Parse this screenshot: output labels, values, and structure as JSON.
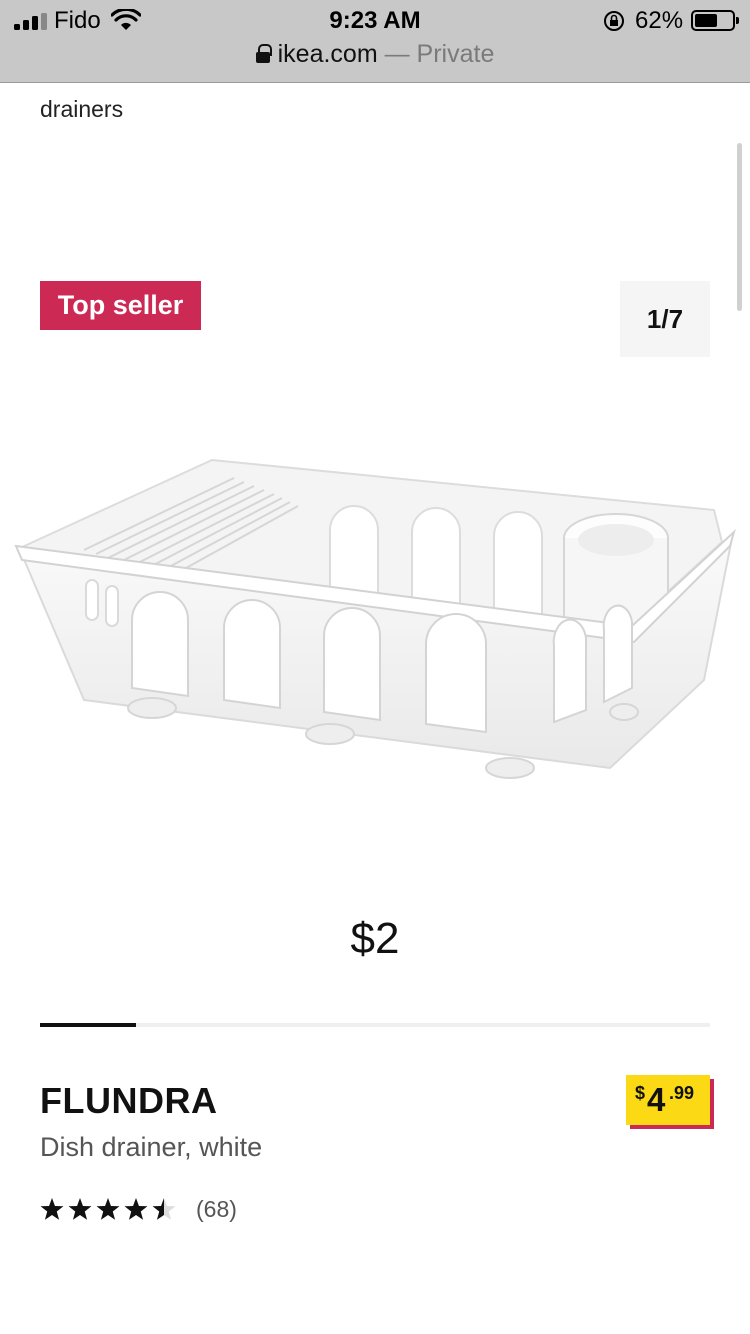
{
  "status_bar": {
    "carrier": "Fido",
    "time": "9:23 AM",
    "battery_percent": "62%",
    "battery_level": 0.62
  },
  "browser": {
    "domain": "ikea.com",
    "mode": "— Private"
  },
  "breadcrumb": "drainers",
  "gallery": {
    "badge": "Top seller",
    "counter": "1/7",
    "slide_price": "$2",
    "progress_fraction": 0.1428
  },
  "product": {
    "name": "FLUNDRA",
    "description": "Dish drainer, white",
    "price": {
      "currency": "$",
      "integer": "4",
      "decimal": ".99"
    },
    "rating": {
      "value": 4.5,
      "max": 5,
      "count": "(68)"
    }
  },
  "colors": {
    "badge_bg": "#cc2a54",
    "price_tag_bg": "#fbd914",
    "price_tag_shadow": "#cc2a54"
  }
}
